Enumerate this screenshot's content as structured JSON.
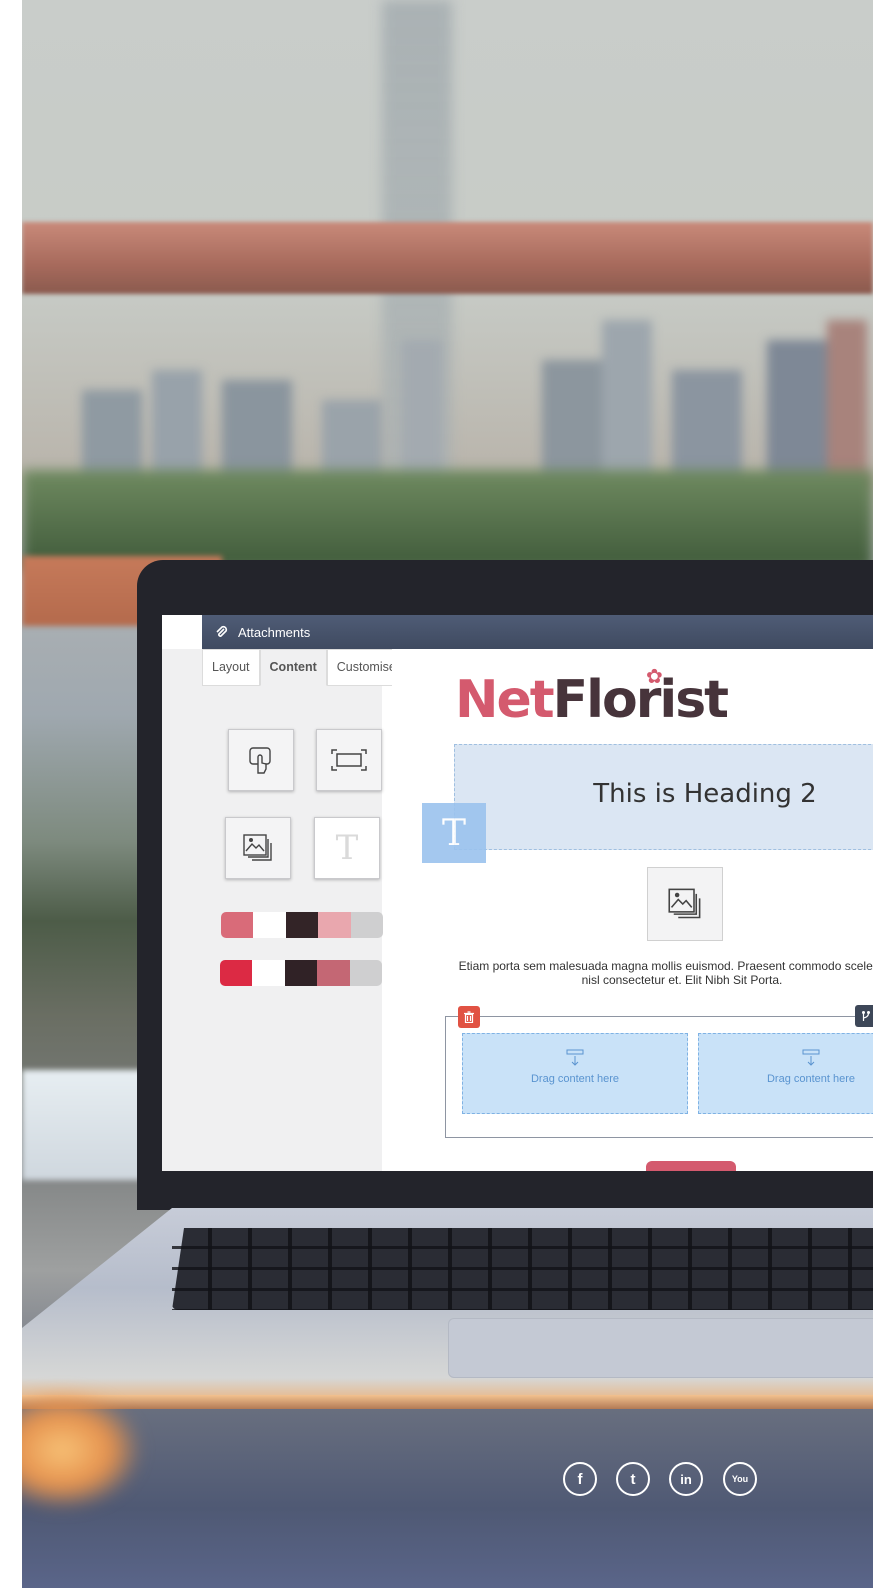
{
  "window": {
    "title": "Attachments"
  },
  "sidebar": {
    "tabs": [
      {
        "label": "Layout"
      },
      {
        "label": "Content"
      },
      {
        "label": "Customise"
      }
    ],
    "active_tab": "Content",
    "tools": [
      "touch-icon",
      "spacer-icon",
      "image-icon",
      "text-icon"
    ],
    "palettes": [
      [
        "#d96b79",
        "#ffffff",
        "#332427",
        "#e9a7ae",
        "#cfcfd0"
      ],
      [
        "#dc2a44",
        "#ffffff",
        "#302226",
        "#c46774",
        "#cfcfd0"
      ]
    ]
  },
  "editor": {
    "logo_net": "Net",
    "logo_florist": "Florist",
    "heading": "This is Heading 2",
    "paragraph": "Etiam porta sem malesuada magna mollis euismod. Praesent commodo scelerisque nisl consectetur et. Elit Nibh Sit Porta.",
    "dropzone_left": "Drag content here",
    "dropzone_right": "Drag content here",
    "dragged_letter": "T"
  },
  "social": [
    {
      "name": "facebook-icon",
      "glyph": "f"
    },
    {
      "name": "twitter-icon",
      "glyph": "t"
    },
    {
      "name": "linkedin-icon",
      "glyph": "in"
    },
    {
      "name": "youtube-icon",
      "glyph": "You"
    }
  ],
  "colors": {
    "brand_pink": "#d45a6e",
    "brand_dark": "#47343b",
    "accent_blue": "#9bc3ee"
  }
}
